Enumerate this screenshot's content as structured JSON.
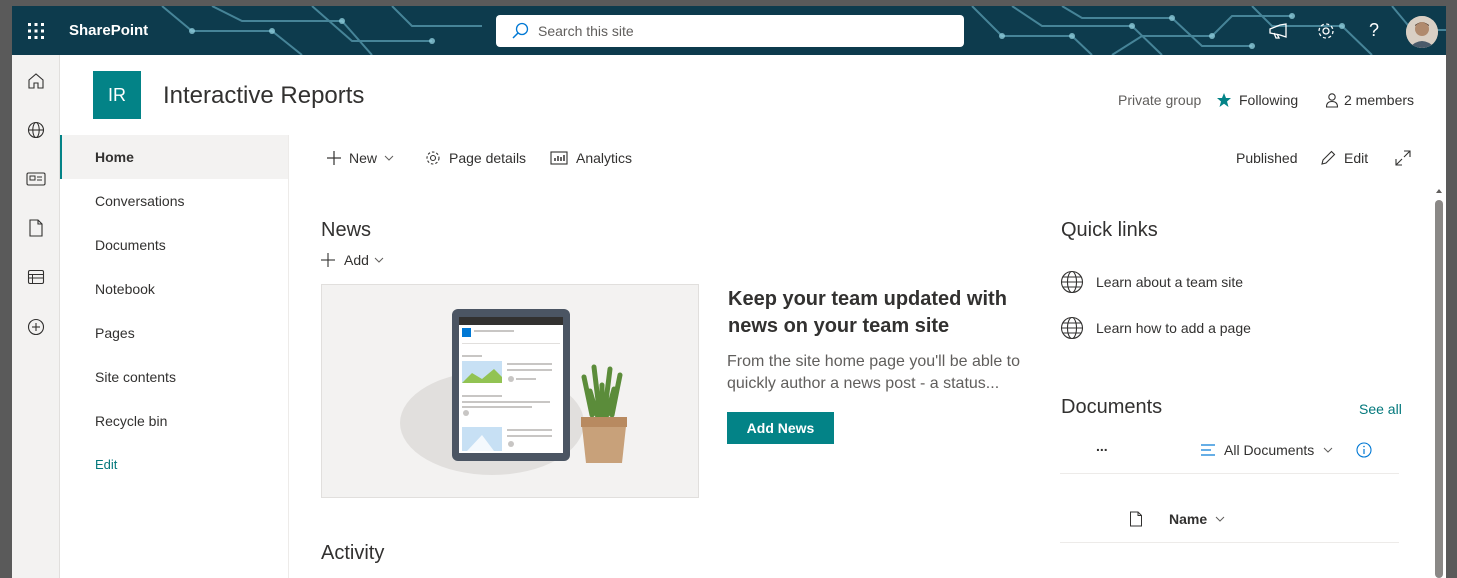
{
  "suite": {
    "app_name": "SharePoint",
    "search_placeholder": "Search this site"
  },
  "site": {
    "logo_initials": "IR",
    "title": "Interactive Reports",
    "privacy": "Private group",
    "following_label": "Following",
    "members_label": "2 members"
  },
  "nav": {
    "items": [
      "Home",
      "Conversations",
      "Documents",
      "Notebook",
      "Pages",
      "Site contents",
      "Recycle bin"
    ],
    "edit_label": "Edit"
  },
  "commandbar": {
    "new_label": "New",
    "page_details_label": "Page details",
    "analytics_label": "Analytics",
    "status_label": "Published",
    "edit_label": "Edit"
  },
  "news": {
    "title": "News",
    "add_label": "Add",
    "headline": "Keep your team updated with news on your team site",
    "description": "From the site home page you'll be able to quickly author a news post - a status...",
    "button_label": "Add News"
  },
  "activity": {
    "title": "Activity"
  },
  "quick_links": {
    "title": "Quick links",
    "items": [
      "Learn about a team site",
      "Learn how to add a page"
    ]
  },
  "documents": {
    "title": "Documents",
    "see_all_label": "See all",
    "more_label": "...",
    "view_label": "All Documents",
    "name_column": "Name"
  },
  "colors": {
    "accent": "#038387",
    "suitebar": "#0d3b4d",
    "link": "#03787c"
  }
}
